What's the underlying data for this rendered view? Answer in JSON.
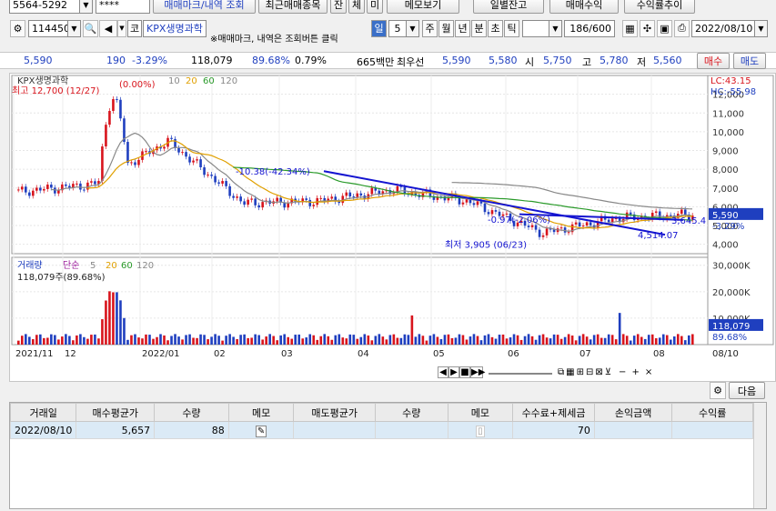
{
  "toolbar1": {
    "account": "5564-5292",
    "password": "****",
    "btn_trades": "매매마크/내역 조회",
    "btn_recent": "최근매매종목",
    "btn_jan": "잔",
    "btn_che": "체",
    "btn_mi": "미",
    "btn_memo": "메모보기",
    "btn_daily": "일별잔고",
    "btn_profit": "매매수익",
    "btn_rate": "수익률추이"
  },
  "toolbar2": {
    "code": "114450",
    "market": "코",
    "stock_name": "KPX생명과학",
    "hint": "※매매마크, 내역은 조회버튼 클릭",
    "period_sel": "일",
    "period_num": "5",
    "periods": [
      "주",
      "월",
      "년",
      "분",
      "초",
      "틱"
    ],
    "count": "186/600",
    "date": "2022/08/10"
  },
  "quote": {
    "price": "5,590",
    "change": "190",
    "change_pct": "-3.29%",
    "volume": "118,079",
    "volume_ratio": "89.68%",
    "turnover": "0.79%",
    "value": "665백만",
    "best_label": "최우선",
    "ask": "5,590",
    "bid": "5,580",
    "open_label": "시",
    "open": "5,750",
    "high_label": "고",
    "high": "5,780",
    "low_label": "저",
    "low": "5,560",
    "buy": "매수",
    "sell": "매도"
  },
  "price_chart": {
    "legend_name": "KPX생명과학",
    "ma_values": [
      "10",
      "20",
      "60",
      "120"
    ],
    "max_label": "최고 12,700 (12/27)",
    "max_pct": "(0.00%)",
    "min_label": "최저 3,905 (06/23)",
    "trend1": "-10.38(-42.34%)",
    "trend2": "-0.97(-2.06%)",
    "trend_end": "4,514.07",
    "trend_end2": "3,645.4",
    "lc": "LC:43.15",
    "hc": "HC:-55.98",
    "price_tag": "5,590",
    "pct_tag": "-3.29%",
    "y_ticks": [
      "12,000",
      "11,000",
      "10,000",
      "9,000",
      "8,000",
      "7,000",
      "6,000",
      "5,000",
      "4,000"
    ],
    "y_values": [
      12000,
      11000,
      10000,
      9000,
      8000,
      7000,
      6000,
      5000,
      4000
    ]
  },
  "volume_chart": {
    "legend_name": "거래량",
    "ma_label": "단순",
    "ma_values": [
      "5",
      "20",
      "60",
      "120"
    ],
    "current": "118,079주(89.68%)",
    "y_ticks": [
      "30,000K",
      "20,000K",
      "10,000K"
    ],
    "y_values": [
      30000,
      20000,
      10000
    ],
    "tag": "118,079",
    "tag_pct": "89.68%"
  },
  "x_axis": {
    "labels": [
      "2021/11",
      "12",
      "2022/01",
      "02",
      "03",
      "04",
      "05",
      "06",
      "07",
      "08"
    ],
    "last_date": "08/10"
  },
  "grid": {
    "next_btn": "다음",
    "headers": [
      "거래일",
      "매수평균가",
      "수량",
      "메모",
      "매도평균가",
      "수량",
      "메모",
      "수수료+제세금",
      "손익금액",
      "수익률"
    ],
    "rows": [
      [
        "2022/08/10",
        "5,657",
        "88",
        "",
        "",
        "",
        "",
        "70",
        "",
        ""
      ]
    ]
  },
  "chart_data": {
    "type": "candlestick",
    "x": [
      "2021/11",
      "12",
      "2022/01",
      "02",
      "03",
      "04",
      "05",
      "06",
      "07",
      "08"
    ],
    "close": [
      6800,
      7200,
      9500,
      6200,
      6300,
      6900,
      6300,
      4600,
      5400,
      5590
    ],
    "ylim": [
      3500,
      13000
    ],
    "volume_ylim": [
      0,
      33000
    ],
    "grid": true
  },
  "colors": {
    "up": "#d8141c",
    "down": "#1f3fbf",
    "ma10": "#888888",
    "ma20": "#e0a000",
    "ma60": "#2a9a2a",
    "ma120": "#888888",
    "trend": "#1414d0"
  }
}
